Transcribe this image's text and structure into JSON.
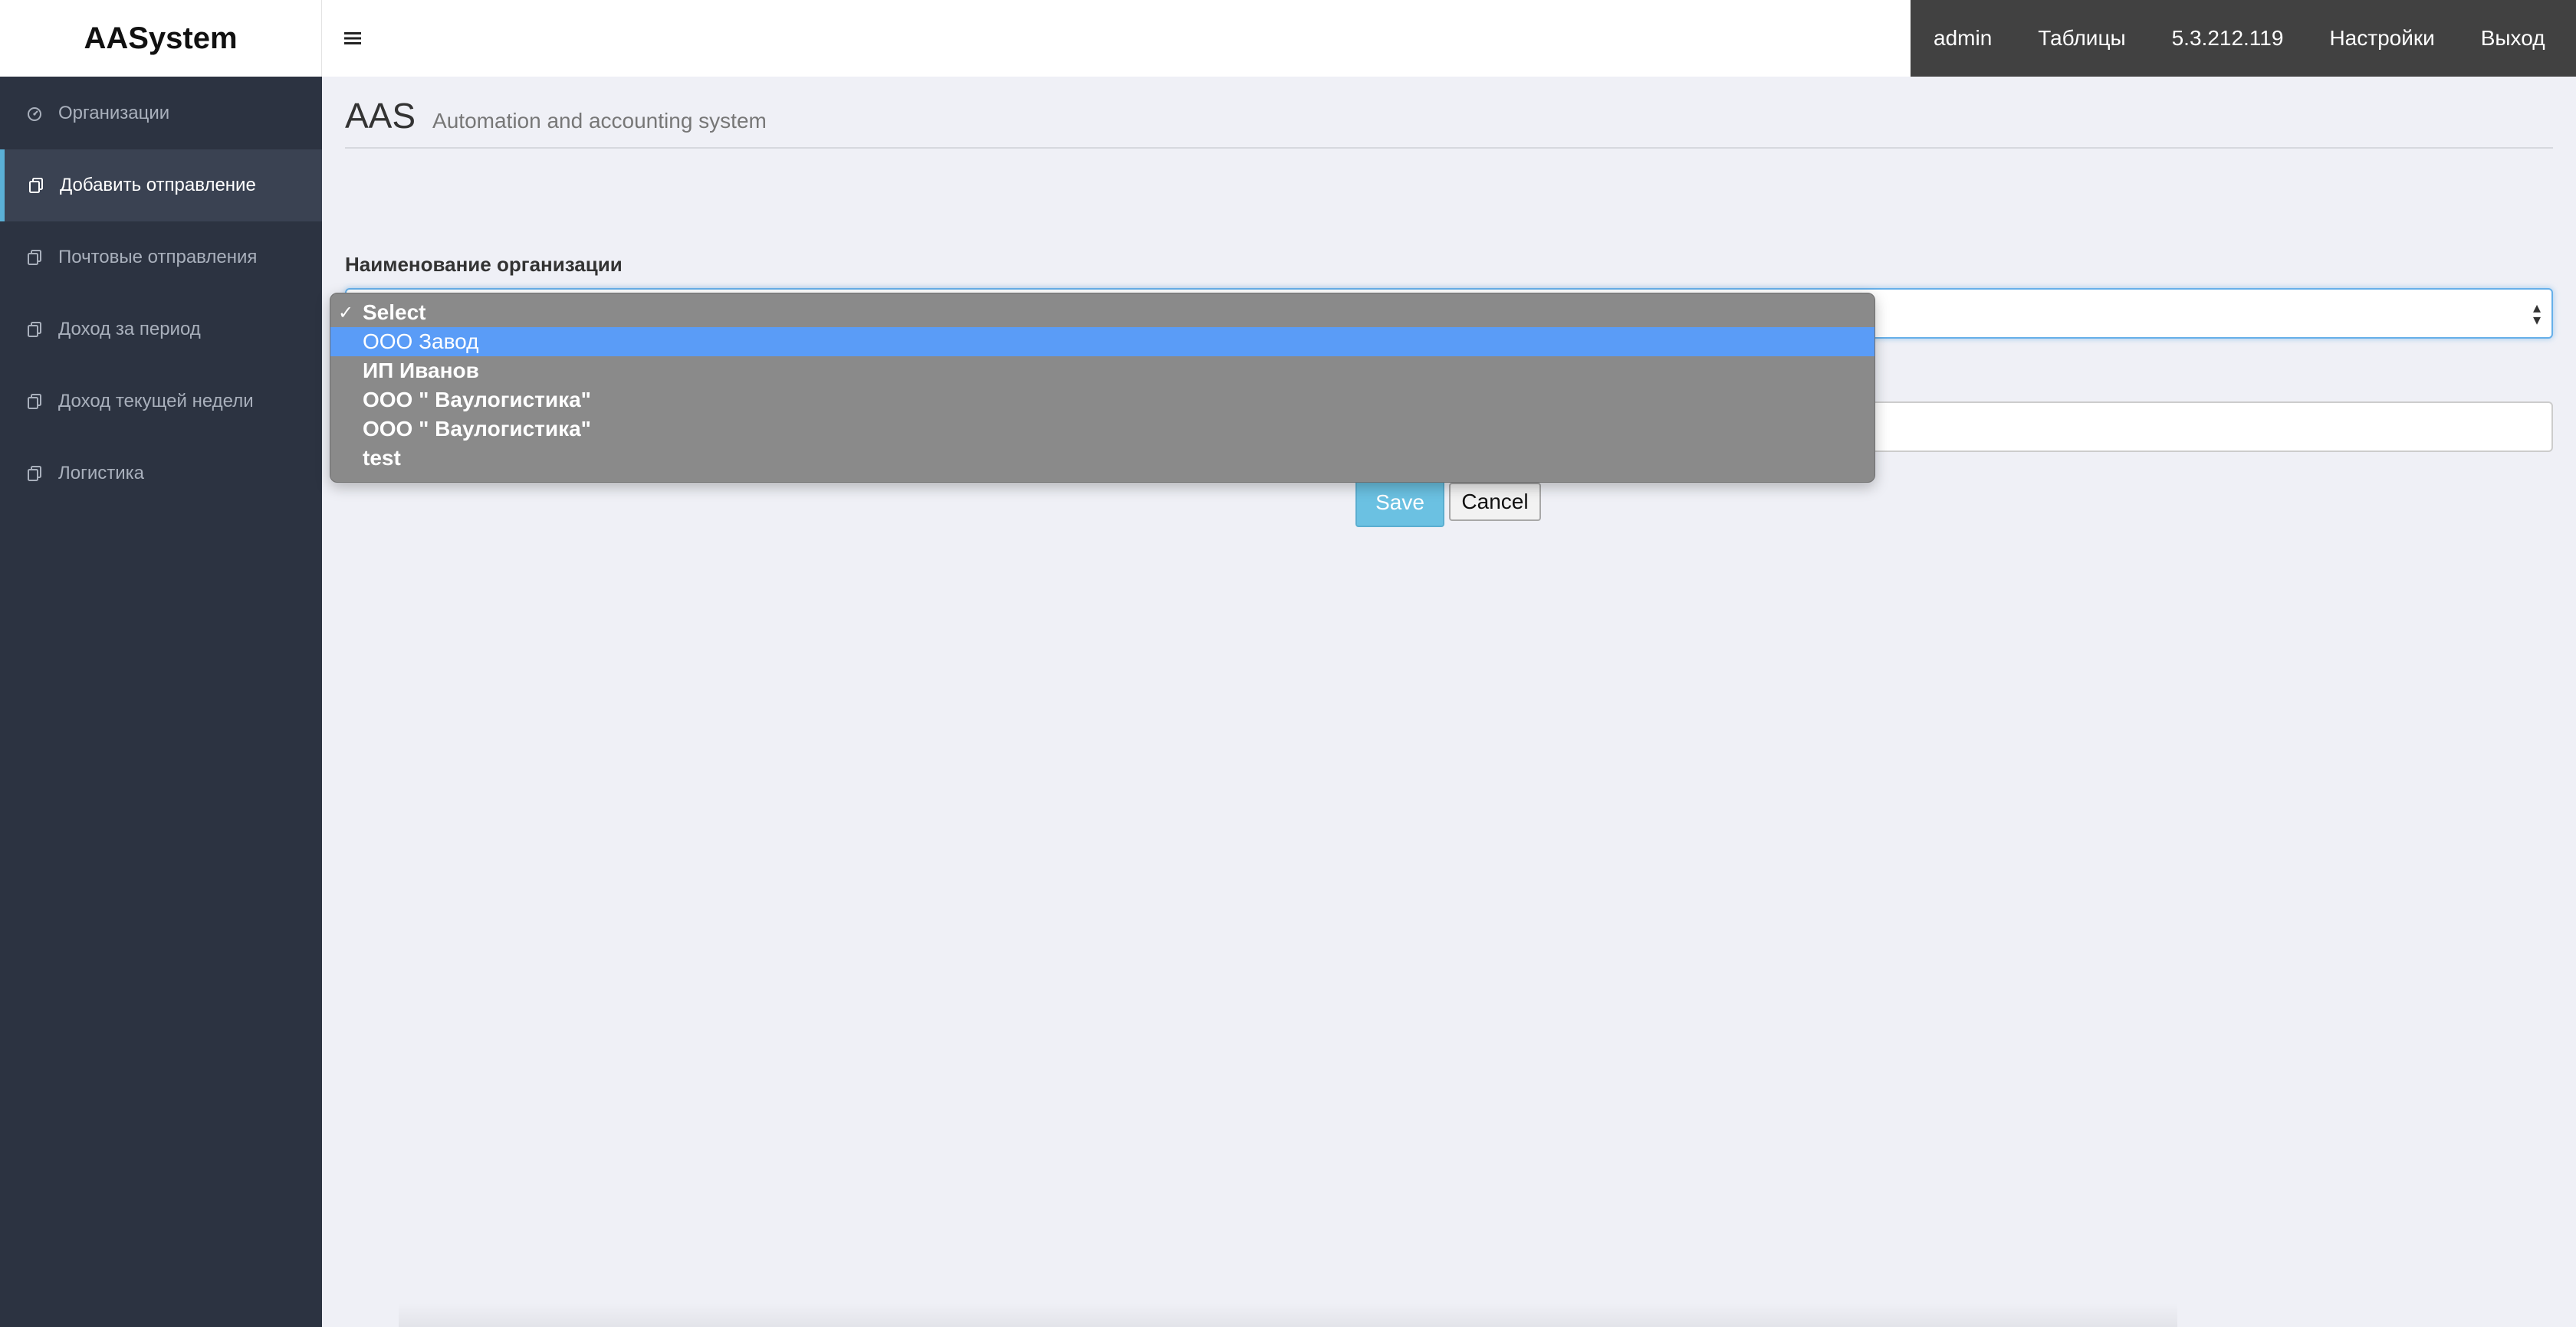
{
  "app": {
    "brand": "AASystem"
  },
  "sidebar": {
    "items": [
      {
        "label": "Организации",
        "icon": "dashboard-icon",
        "active": false
      },
      {
        "label": "Добавить отправление",
        "icon": "copy-icon",
        "active": true
      },
      {
        "label": "Почтовые отправления",
        "icon": "copy-icon",
        "active": false
      },
      {
        "label": "Доход за период",
        "icon": "copy-icon",
        "active": false
      },
      {
        "label": "Доход текущей недели",
        "icon": "copy-icon",
        "active": false
      },
      {
        "label": "Логистика",
        "icon": "copy-icon",
        "active": false
      }
    ]
  },
  "topbar": {
    "menu_icon": "hamburger-icon",
    "links": [
      "admin",
      "Таблицы",
      "5.3.212.119",
      "Настройки",
      "Выход"
    ]
  },
  "header": {
    "title": "AAS",
    "subtitle": "Automation and accounting system"
  },
  "form": {
    "organization_label": "Наименование организации",
    "save_label": "Save",
    "cancel_label": "Cancel"
  },
  "dropdown": {
    "selected": "Select",
    "highlighted": "ООО Завод",
    "options": [
      "Select",
      "ООО Завод",
      "ИП Иванов",
      "ООО \" Ваулогистика\"",
      "ООО \" Ваулогистика\"",
      "test"
    ]
  },
  "colors": {
    "sidebar_bg": "#2c3341",
    "active_accent": "#5ab0d6",
    "topnav_bg": "#414141",
    "save_button": "#6bc1e2",
    "dropdown_highlight": "#5a9cf7"
  }
}
